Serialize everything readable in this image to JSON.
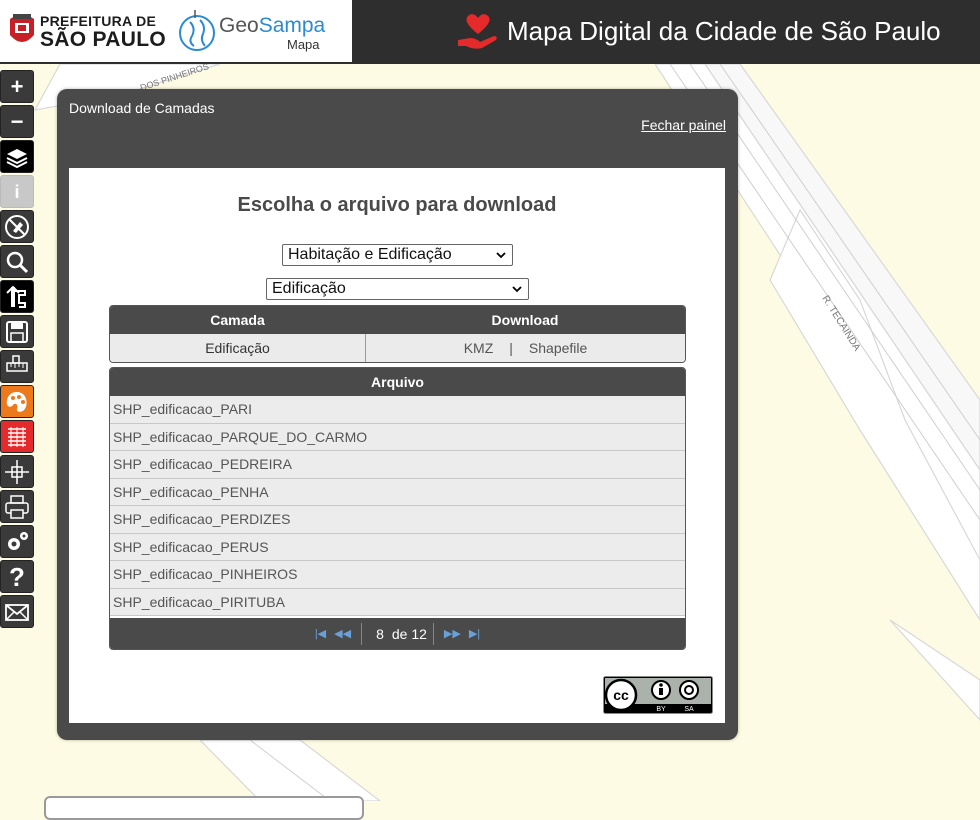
{
  "header": {
    "pref_line1": "PREFEITURA DE",
    "pref_line2": "SÃO PAULO",
    "geo_part1": "Geo",
    "geo_part2": "Sampa",
    "geo_sub": "Mapa",
    "app_title": "Mapa Digital da Cidade de São Paulo"
  },
  "map": {
    "street_labels": [
      "DOS PINHEIROS",
      "R. TECAINDA"
    ]
  },
  "toolbar": {
    "items": [
      "zoom-in",
      "zoom-out",
      "layers",
      "info",
      "no-edit",
      "search",
      "route",
      "save",
      "measure",
      "palette",
      "legend",
      "coordinate",
      "print",
      "settings",
      "help",
      "email"
    ]
  },
  "panel": {
    "title": "Download de Camadas",
    "close_label": "Fechar painel",
    "heading": "Escolha o arquivo para download",
    "category_select": "Habitação e Edificação",
    "subcategory_select": "Edificação",
    "layers_table": {
      "headers": [
        "Camada",
        "Download"
      ],
      "row": {
        "layer": "Edificação",
        "kmz": "KMZ",
        "separator": "|",
        "shapefile": "Shapefile"
      }
    },
    "files_table": {
      "header": "Arquivo",
      "rows": [
        "SHP_edificacao_PARI",
        "SHP_edificacao_PARQUE_DO_CARMO",
        "SHP_edificacao_PEDREIRA",
        "SHP_edificacao_PENHA",
        "SHP_edificacao_PERDIZES",
        "SHP_edificacao_PERUS",
        "SHP_edificacao_PINHEIROS",
        "SHP_edificacao_PIRITUBA"
      ],
      "pager": {
        "current": "8",
        "of_label": "de 12"
      }
    },
    "license": {
      "badge_text_by": "BY",
      "badge_text_sa": "SA"
    }
  },
  "colors": {
    "header_bg": "#2e2e2e",
    "panel_bg": "#4a4a4a",
    "map_bg": "#fdfbe3",
    "accent_blue": "#2b8ad2",
    "heart_red": "#e42a2a"
  }
}
